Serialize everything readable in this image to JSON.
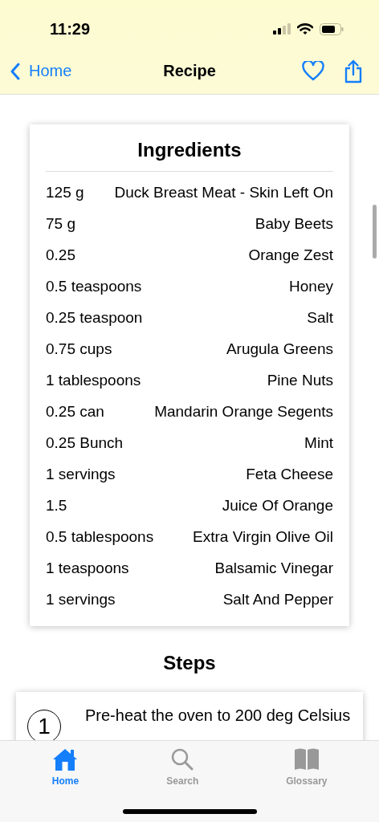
{
  "status_bar": {
    "time": "11:29"
  },
  "nav_bar": {
    "back_label": "Home",
    "title": "Recipe"
  },
  "ingredients": {
    "title": "Ingredients",
    "items": [
      {
        "amount": "125 g",
        "name": "Duck Breast Meat - Skin Left On"
      },
      {
        "amount": "75 g",
        "name": "Baby Beets"
      },
      {
        "amount": "0.25",
        "name": "Orange Zest"
      },
      {
        "amount": "0.5 teaspoons",
        "name": "Honey"
      },
      {
        "amount": "0.25 teaspoon",
        "name": "Salt"
      },
      {
        "amount": "0.75 cups",
        "name": "Arugula Greens"
      },
      {
        "amount": "1 tablespoons",
        "name": "Pine Nuts"
      },
      {
        "amount": "0.25 can",
        "name": "Mandarin Orange Segents"
      },
      {
        "amount": "0.25 Bunch",
        "name": "Mint"
      },
      {
        "amount": "1 servings",
        "name": "Feta Cheese"
      },
      {
        "amount": "1.5",
        "name": "Juice Of Orange"
      },
      {
        "amount": "0.5 tablespoons",
        "name": "Extra Virgin Olive Oil"
      },
      {
        "amount": "1 teaspoons",
        "name": "Balsamic Vinegar"
      },
      {
        "amount": "1 servings",
        "name": "Salt And Pepper"
      }
    ]
  },
  "steps": {
    "title": "Steps",
    "items": [
      {
        "number": "1",
        "text": "Pre-heat the oven to 200 deg Celsius"
      }
    ]
  },
  "tab_bar": [
    {
      "label": "Home",
      "selected": true
    },
    {
      "label": "Search",
      "selected": false
    },
    {
      "label": "Glossary",
      "selected": false
    }
  ]
}
